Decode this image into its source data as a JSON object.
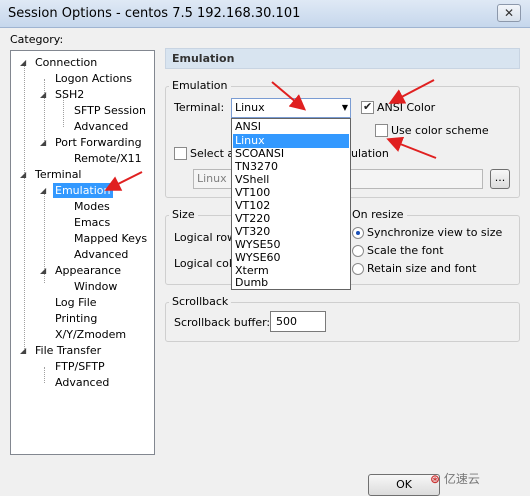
{
  "window": {
    "title": "Session Options - centos 7.5 192.168.30.101",
    "close_glyph": "✕"
  },
  "category_label": "Category:",
  "tree": {
    "connection": "Connection",
    "logon_actions": "Logon Actions",
    "ssh2": "SSH2",
    "sftp_session": "SFTP Session",
    "ssh2_advanced": "Advanced",
    "port_forwarding": "Port Forwarding",
    "remote_x11": "Remote/X11",
    "terminal": "Terminal",
    "emulation": "Emulation",
    "modes": "Modes",
    "emacs": "Emacs",
    "mapped_keys": "Mapped Keys",
    "emulation_advanced": "Advanced",
    "appearance": "Appearance",
    "window": "Window",
    "log_file": "Log File",
    "printing": "Printing",
    "xyz_modem": "X/Y/Zmodem",
    "file_transfer": "File Transfer",
    "ftp_sftp": "FTP/SFTP",
    "ft_advanced": "Advanced"
  },
  "panel": {
    "header": "Emulation",
    "emulation_group": {
      "label": "Emulation",
      "terminal_label": "Terminal:",
      "terminal_value": "Linux",
      "ansi_color_label": "ANSI Color",
      "ansi_color_checked": true,
      "use_color_scheme_label": "Use color scheme",
      "use_color_scheme_checked": false,
      "select_alt_label_start": "Select an",
      "select_alt_label_end": "ulation",
      "alt_value": "Linux",
      "browse_label": "..."
    },
    "dropdown_options": [
      "ANSI",
      "Linux",
      "SCOANSI",
      "TN3270",
      "VShell",
      "VT100",
      "VT102",
      "VT220",
      "VT320",
      "WYSE50",
      "WYSE60",
      "Xterm",
      "Dumb"
    ],
    "dropdown_selected": "Linux",
    "size_group": {
      "label": "Size",
      "logical_rows_label": "Logical rows",
      "logical_cols_label": "Logical colur"
    },
    "on_resize_group": {
      "label": "On resize",
      "options": [
        "Synchronize view to size",
        "Scale the font",
        "Retain size and font"
      ],
      "selected": "Synchronize view to size"
    },
    "scrollback_group": {
      "label": "Scrollback",
      "buffer_label": "Scrollback buffer:",
      "buffer_value": "500"
    }
  },
  "buttons": {
    "ok": "OK"
  },
  "watermark": "亿速云",
  "colors": {
    "selection": "#3399ff",
    "annotation_arrow": "#e02020"
  }
}
